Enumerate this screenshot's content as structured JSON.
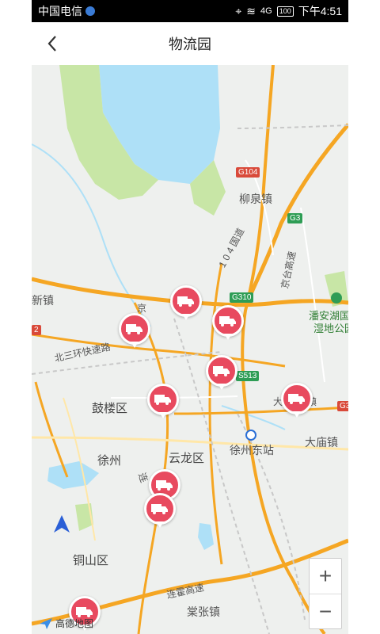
{
  "status_bar": {
    "carrier": "中国电信",
    "time": "下午4:51",
    "battery": "100",
    "network": "4G"
  },
  "header": {
    "title": "物流园",
    "back_icon": "chevron-left-icon"
  },
  "map": {
    "district_labels": [
      "鼓楼区",
      "云龙区",
      "铜山区",
      "徐州",
      "徐州东站",
      "柳泉镇",
      "大庙镇",
      "棠张镇",
      "新镇"
    ],
    "park_label": [
      "潘安湖国",
      "湿地公园"
    ],
    "road_labels": [
      "北三环快速路",
      "1 0 4 国道",
      "京台高速",
      "连霍高速",
      "京",
      "连",
      "大",
      "镇"
    ],
    "shields": [
      "G104",
      "G3",
      "G310",
      "S513",
      "G3",
      "2"
    ],
    "pin_icon": "truck-icon",
    "pin_count": 10,
    "zoom_in": "+",
    "zoom_out": "−",
    "logo_text": "高德地图",
    "nav_icon": "navigation-arrow-icon"
  },
  "colors": {
    "pin": "#e84a5f",
    "highway": "#f5a623",
    "water": "#aee0f7",
    "green": "#c8e6a6"
  }
}
